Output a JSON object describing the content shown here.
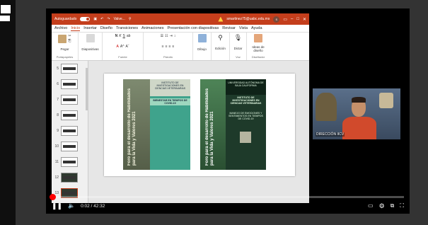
{
  "ppt": {
    "qat": {
      "autosave_label": "Autoguardado",
      "file_name": "Valve...",
      "account": "smartinez75@uabc.edu.mx",
      "avatar_initial": "S"
    },
    "menu": [
      "Archivo",
      "Inicio",
      "Insertar",
      "Diseño",
      "Transiciones",
      "Animaciones",
      "Presentación con diapositivas",
      "Revisar",
      "Vista",
      "Ayuda"
    ],
    "ribbon": {
      "paste": "Pegar",
      "clipboard_group": "Portapapeles",
      "slides": "Diapositivas",
      "font_group": "Fuente",
      "paragraph_group": "Párrafo",
      "draw": "Dibujo",
      "edit": "Edición",
      "dictate": "Dictar",
      "voice_group": "Voz",
      "designer_line1": "Ideas de",
      "designer_line2": "diseño",
      "designer_group": "Diseñador"
    },
    "thumbs": [
      {
        "num": "5",
        "dark": false
      },
      {
        "num": "6",
        "dark": false
      },
      {
        "num": "7",
        "dark": false
      },
      {
        "num": "8",
        "dark": false
      },
      {
        "num": "9",
        "dark": false
      },
      {
        "num": "10",
        "dark": false
      },
      {
        "num": "11",
        "dark": false
      },
      {
        "num": "12",
        "dark": true
      },
      {
        "num": "13",
        "dark": true
      }
    ],
    "slide": {
      "poster1_vertical": "Foro para el desarrollo de Habilidades para la Vida y Valores 2021",
      "poster1_head": "INSTITUTO DE INVESTIGACIONES EN CIENCIAS VETERINARIAS",
      "poster1_topic": "BIENESTAR EN TIEMPOS DE COVID-19",
      "poster2_vertical": "Foro para el desarrollo de Habilidades para la Vida y Valores 2021",
      "poster2_head": "UNIVERSIDAD AUTÓNOMA DE BAJA CALIFORNIA",
      "poster2_institute": "INSTITUTO DE INVESTIGACIONES EN CIENCIAS VETERINARIAS",
      "poster2_topic": "MANEJO DE EMOCIONES Y SENTIMIENTOS EN TIEMPOS DE COVID-19"
    }
  },
  "webcam": {
    "label": "DIRECCIÓN IICV"
  },
  "player": {
    "current_time": "0:02",
    "duration": "42:32",
    "progress_fraction": 0.002
  }
}
